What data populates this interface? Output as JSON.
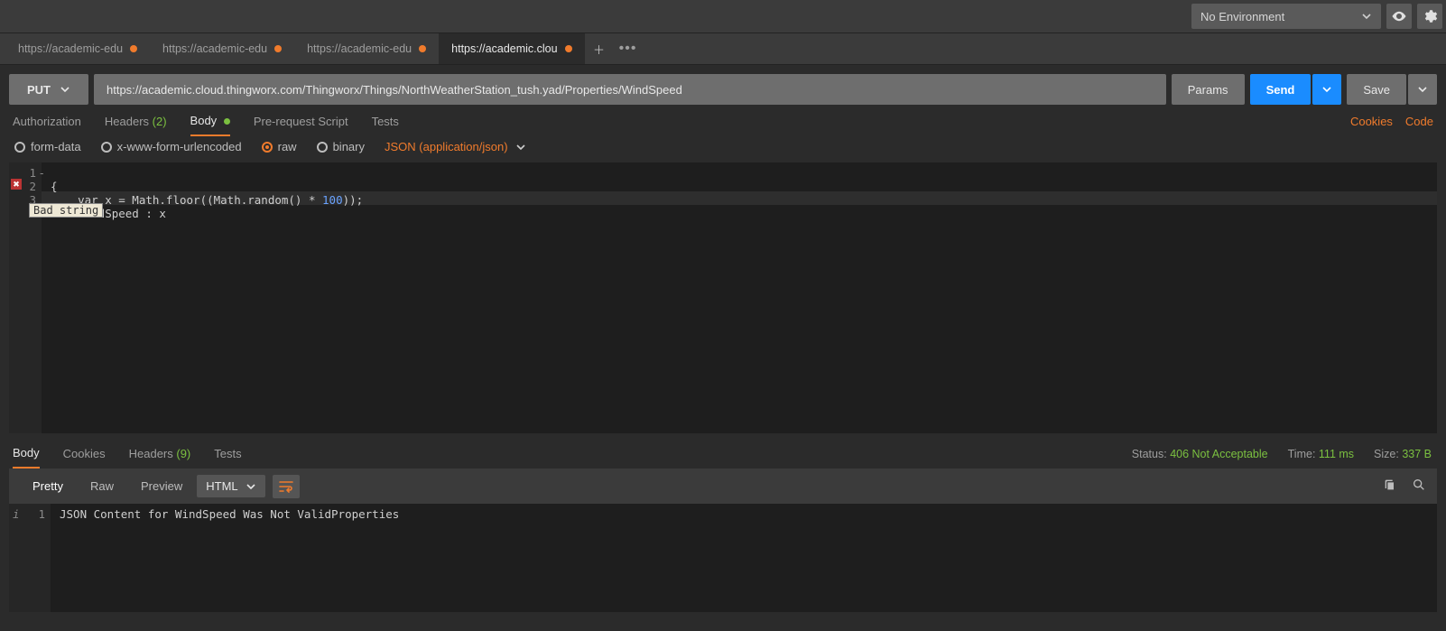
{
  "env": {
    "label": "No Environment"
  },
  "tabs": [
    {
      "label": "https://academic-edu",
      "dirty": true
    },
    {
      "label": "https://academic-edu",
      "dirty": true
    },
    {
      "label": "https://academic-edu",
      "dirty": true
    },
    {
      "label": "https://academic.clou",
      "dirty": true
    }
  ],
  "active_tab": 3,
  "request": {
    "method": "PUT",
    "url": "https://academic.cloud.thingworx.com/Thingworx/Things/NorthWeatherStation_tush.yad/Properties/WindSpeed",
    "params_btn": "Params",
    "send_btn": "Send",
    "save_btn": "Save"
  },
  "req_subtabs": {
    "authorization": "Authorization",
    "headers": "Headers",
    "headers_count": "(2)",
    "body": "Body",
    "prerequest": "Pre-request Script",
    "tests": "Tests",
    "cookies_link": "Cookies",
    "code_link": "Code"
  },
  "body_opts": {
    "formdata": "form-data",
    "xform": "x-www-form-urlencoded",
    "raw": "raw",
    "binary": "binary",
    "mime": "JSON (application/json)"
  },
  "editor": {
    "lines": [
      "1",
      "2",
      "3"
    ],
    "l1_open": "{",
    "l2_a": "    var x = Math.floor((Math.random() * ",
    "l2_num": "100",
    "l2_b": "));",
    "l3": "    WindSpeed : x",
    "error_tooltip": "Bad string",
    "fold_marker": "-"
  },
  "resp_tabs": {
    "body": "Body",
    "cookies": "Cookies",
    "headers": "Headers",
    "headers_count": "(9)",
    "tests": "Tests"
  },
  "resp_meta": {
    "status_lbl": "Status:",
    "status_val": "406 Not Acceptable",
    "time_lbl": "Time:",
    "time_val": "111 ms",
    "size_lbl": "Size:",
    "size_val": "337 B"
  },
  "resp_tool": {
    "pretty": "Pretty",
    "raw": "Raw",
    "preview": "Preview",
    "lang": "HTML"
  },
  "resp_body": {
    "line_no": "1",
    "text": "JSON Content for WindSpeed Was Not ValidProperties"
  }
}
